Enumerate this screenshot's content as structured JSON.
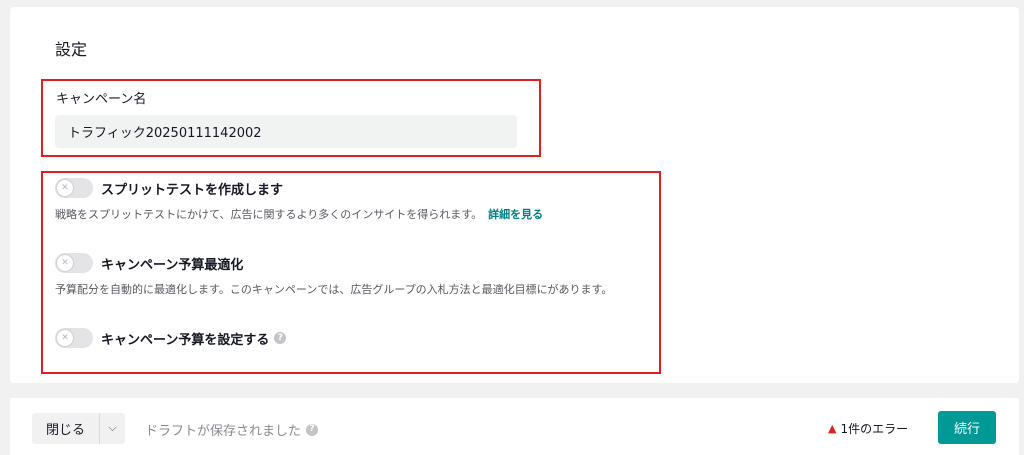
{
  "settings": {
    "title": "設定",
    "campaign_name": {
      "label": "キャンペーン名",
      "value": "トラフィック20250111142002"
    },
    "options": [
      {
        "label": "スプリットテストを作成します",
        "description": "戦略をスプリットテストにかけて、広告に関するより多くのインサイトを得られます。",
        "link": "詳細を見る",
        "enabled": false
      },
      {
        "label": "キャンペーン予算最適化",
        "description": "予算配分を自動的に最適化します。このキャンペーンでは、広告グループの入札方法と最適化目標にがあります。",
        "enabled": false
      },
      {
        "label": "キャンペーン予算を設定する",
        "help": "?",
        "enabled": false
      }
    ]
  },
  "footer": {
    "close_label": "閉じる",
    "draft_status": "ドラフトが保存されました",
    "draft_help": "?",
    "error_text": "1件のエラー",
    "continue_label": "続行"
  },
  "colors": {
    "accent": "#009995",
    "highlight": "#e02020",
    "link": "#007f84"
  }
}
